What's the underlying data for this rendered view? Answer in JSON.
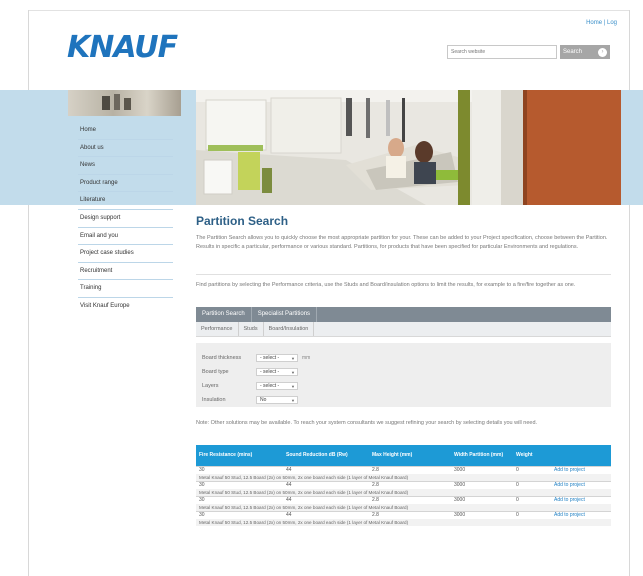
{
  "header": {
    "link_label": "Home | Log",
    "logo_text": "KNAUF"
  },
  "search": {
    "placeholder": "Search website",
    "button_label": "Search",
    "go_glyph": "›"
  },
  "nav": {
    "items": [
      {
        "label": "Home"
      },
      {
        "label": "About us"
      },
      {
        "label": "News"
      },
      {
        "label": "Product range"
      },
      {
        "label": "Literature"
      },
      {
        "label": "Design support"
      },
      {
        "label": "Email and you"
      },
      {
        "label": "Project case studies"
      },
      {
        "label": "Recruitment"
      },
      {
        "label": "Training"
      },
      {
        "label": "Visit Knauf Europe"
      }
    ]
  },
  "main": {
    "title": "Partition Search",
    "intro": "The Partition Search allows you to quickly choose the most appropriate partition for your. These can be added to your Project specification, choose between the Partition. Results in specific a particular, performance or various standard. Partitions, for products that have been specified for particular Environments and regulations.",
    "instructions": "Find partitions by selecting the Performance criteria, use the Studs and Board/insulation options to limit the results, for example to a fire/fire together as one.",
    "tabs_primary": [
      "Partition Search",
      "Specialist Partitions"
    ],
    "tabs_secondary": [
      "Performance",
      "Studs",
      "Board/Insulation"
    ],
    "filters": [
      {
        "label": "Board thickness",
        "value": "- select -",
        "unit": "mm"
      },
      {
        "label": "Board type",
        "value": "- select -",
        "unit": ""
      },
      {
        "label": "Layers",
        "value": "- select -",
        "unit": ""
      },
      {
        "label": "Insulation",
        "value": "No",
        "unit": ""
      }
    ],
    "note": "Note: Other solutions may be available. To reach your system consultants we suggest refining your search by selecting details you will need."
  },
  "table": {
    "headers": [
      "Fire Resistance (mins)",
      "Sound Reduction dB (Rw)",
      "Max Height (mm)",
      "Width Partition (mm)",
      "Weight",
      ""
    ],
    "rows": [
      {
        "cells": [
          "30",
          "44",
          "2.8",
          "3000",
          "0"
        ],
        "desc": "Metal Knauf 50 Stud, 12.5 Board (2x) on 50mm, 2x one board each side (1 layer of Metal Knauf Board)",
        "action": "Add to project"
      },
      {
        "cells": [
          "30",
          "44",
          "2.8",
          "3000",
          "0"
        ],
        "desc": "Metal Knauf 50 Stud, 12.5 Board (2x) on 50mm, 2x one board each side (1 layer of Metal Knauf Board)",
        "action": "Add to project"
      },
      {
        "cells": [
          "30",
          "44",
          "2.8",
          "3000",
          "0"
        ],
        "desc": "Metal Knauf 50 Stud, 12.5 Board (2x) on 50mm, 2x one board each side (1 layer of Metal Knauf Board)",
        "action": "Add to project"
      },
      {
        "cells": [
          "30",
          "44",
          "2.8",
          "3000",
          "0"
        ],
        "desc": "Metal Knauf 50 Stud, 12.5 Board (2x) on 50mm, 2x one board each side (1 layer of Metal Knauf Board)",
        "action": "Add to project"
      }
    ]
  },
  "colors": {
    "brand_blue": "#1f74bd",
    "table_header": "#1d9ad6",
    "band": "#c2dceb",
    "tab_dark": "#7f8a94"
  }
}
